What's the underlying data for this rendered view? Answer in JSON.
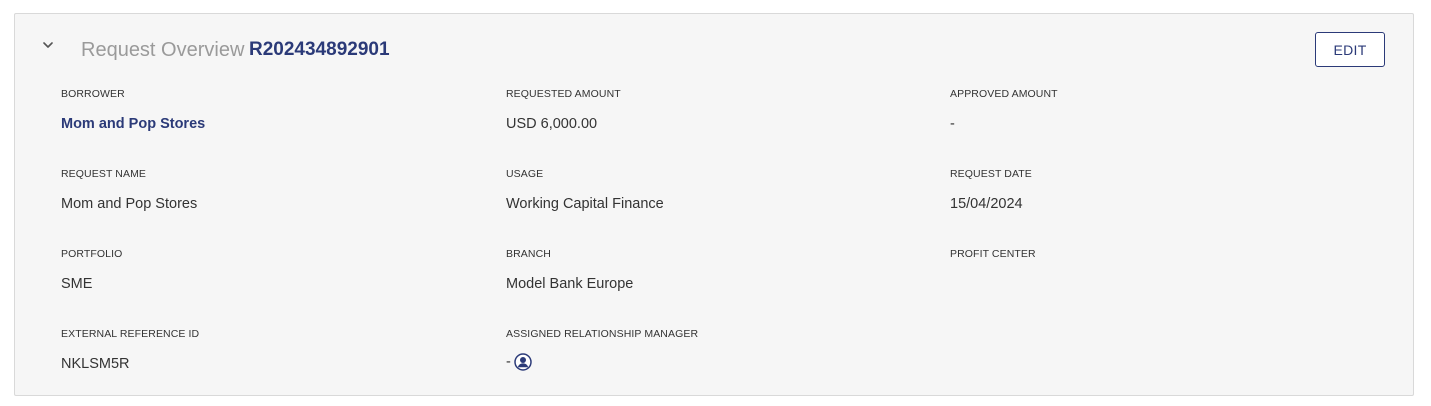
{
  "header": {
    "title": "Request Overview",
    "request_id": "R202434892901",
    "edit_label": "EDIT"
  },
  "fields": {
    "borrower": {
      "label": "BORROWER",
      "value": "Mom and Pop Stores"
    },
    "requested_amount": {
      "label": "REQUESTED AMOUNT",
      "value": "USD 6,000.00"
    },
    "approved_amount": {
      "label": "APPROVED AMOUNT",
      "value": "-"
    },
    "request_name": {
      "label": "REQUEST NAME",
      "value": "Mom and Pop Stores"
    },
    "usage": {
      "label": "USAGE",
      "value": "Working Capital Finance"
    },
    "request_date": {
      "label": "REQUEST DATE",
      "value": "15/04/2024"
    },
    "portfolio": {
      "label": "PORTFOLIO",
      "value": "SME"
    },
    "branch": {
      "label": "BRANCH",
      "value": "Model Bank Europe"
    },
    "profit_center": {
      "label": "PROFIT CENTER",
      "value": ""
    },
    "external_reference_id": {
      "label": "EXTERNAL REFERENCE ID",
      "value": "NKLSM5R"
    },
    "assigned_relationship_manager": {
      "label": "ASSIGNED RELATIONSHIP MANAGER",
      "value": "-",
      "icon": "user-avatar-icon"
    }
  },
  "colors": {
    "accent": "#2b3a78",
    "title_gray": "#9a9a9a",
    "text": "#333333",
    "card_bg": "#f6f6f6",
    "border": "#d9d9d9"
  }
}
